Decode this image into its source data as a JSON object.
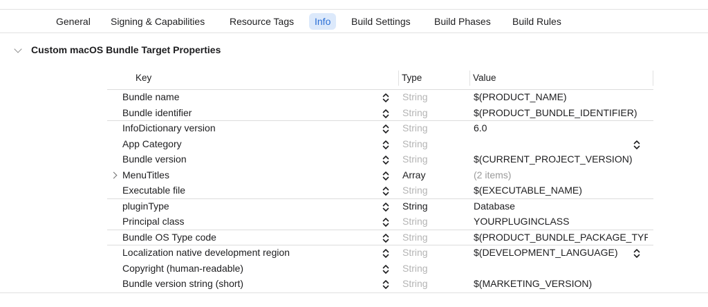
{
  "tabs": [
    {
      "label": "General",
      "selected": false
    },
    {
      "label": "Signing & Capabilities",
      "selected": false
    },
    {
      "label": "Resource Tags",
      "selected": false
    },
    {
      "label": "Info",
      "selected": true
    },
    {
      "label": "Build Settings",
      "selected": false
    },
    {
      "label": "Build Phases",
      "selected": false
    },
    {
      "label": "Build Rules",
      "selected": false
    }
  ],
  "section": {
    "title": "Custom macOS Bundle Target Properties",
    "icon": "chevron-down-icon"
  },
  "columns": {
    "key": "Key",
    "type": "Type",
    "value": "Value"
  },
  "rows": [
    {
      "key": "Bundle name",
      "type": "String",
      "type_dim": true,
      "value": "$(PRODUCT_NAME)",
      "value_dim": false,
      "value_stepper": false,
      "disclosure": false,
      "separator": true
    },
    {
      "key": "Bundle identifier",
      "type": "String",
      "type_dim": true,
      "value": "$(PRODUCT_BUNDLE_IDENTIFIER)",
      "value_dim": false,
      "value_stepper": false,
      "disclosure": false,
      "separator": false
    },
    {
      "key": "InfoDictionary version",
      "type": "String",
      "type_dim": true,
      "value": "6.0",
      "value_dim": false,
      "value_stepper": false,
      "disclosure": false,
      "separator": true
    },
    {
      "key": "App Category",
      "type": "String",
      "type_dim": true,
      "value": "",
      "value_dim": false,
      "value_stepper": true,
      "disclosure": false,
      "separator": false
    },
    {
      "key": "Bundle version",
      "type": "String",
      "type_dim": true,
      "value": "$(CURRENT_PROJECT_VERSION)",
      "value_dim": false,
      "value_stepper": false,
      "disclosure": false,
      "separator": false
    },
    {
      "key": "MenuTitles",
      "type": "Array",
      "type_dim": false,
      "value": "(2 items)",
      "value_dim": true,
      "value_stepper": false,
      "disclosure": true,
      "separator": false
    },
    {
      "key": "Executable file",
      "type": "String",
      "type_dim": true,
      "value": "$(EXECUTABLE_NAME)",
      "value_dim": false,
      "value_stepper": false,
      "disclosure": false,
      "separator": false
    },
    {
      "key": "pluginType",
      "type": "String",
      "type_dim": false,
      "value": "Database",
      "value_dim": false,
      "value_stepper": false,
      "disclosure": false,
      "separator": true
    },
    {
      "key": "Principal class",
      "type": "String",
      "type_dim": true,
      "value": "YOURPLUGINCLASS",
      "value_dim": false,
      "value_stepper": false,
      "disclosure": false,
      "separator": false
    },
    {
      "key": "Bundle OS Type code",
      "type": "String",
      "type_dim": true,
      "value": "$(PRODUCT_BUNDLE_PACKAGE_TYP",
      "value_dim": false,
      "value_stepper": false,
      "disclosure": false,
      "separator": true
    },
    {
      "key": "Localization native development region",
      "type": "String",
      "type_dim": true,
      "value": "$(DEVELOPMENT_LANGUAGE)",
      "value_dim": false,
      "value_stepper": true,
      "disclosure": false,
      "separator": true
    },
    {
      "key": "Copyright (human-readable)",
      "type": "String",
      "type_dim": true,
      "value": "",
      "value_dim": false,
      "value_stepper": false,
      "disclosure": false,
      "separator": false
    },
    {
      "key": "Bundle version string (short)",
      "type": "String",
      "type_dim": true,
      "value": "$(MARKETING_VERSION)",
      "value_dim": false,
      "value_stepper": false,
      "disclosure": false,
      "separator": false
    }
  ],
  "colors": {
    "accent": "#2b6fd6",
    "selected_tab_bg": "#dce9fb",
    "dim_text": "#b4b4b4"
  }
}
